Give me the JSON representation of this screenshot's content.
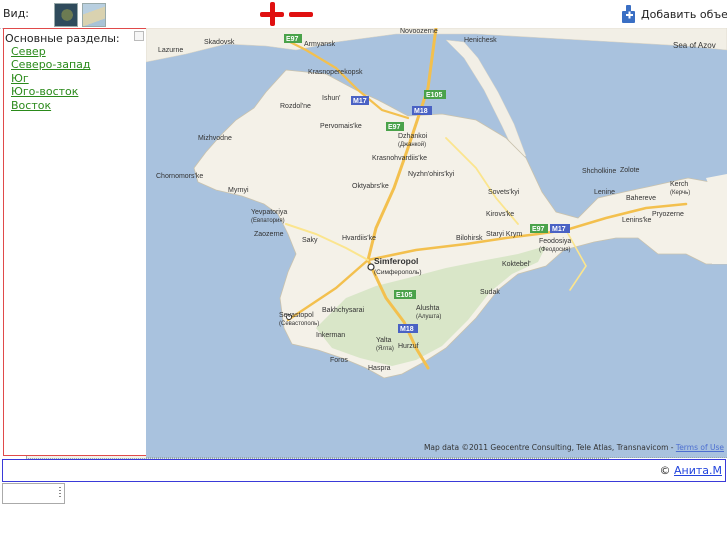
{
  "toolbar": {
    "view_label": "Вид:",
    "view_thumbs": [
      "map-thumbnail",
      "satellite-thumbnail",
      "hybrid-thumbnail"
    ],
    "zoom_in_icon": "plus-icon",
    "zoom_out_icon": "minus-icon",
    "add_object_label": "Добавить объект",
    "add_object_icon": "thumbs-up-plus-icon"
  },
  "sidebar": {
    "title": "Основные разделы:",
    "items": [
      "Север",
      "Северо-запад",
      "Юг",
      "Юго-восток",
      "Восток"
    ]
  },
  "map": {
    "attribution": "Map data ©2011 Geocentre Consulting, Tele Atlas, Transnavicom - ",
    "terms_link": "Terms of Use",
    "labels": {
      "sea_of_azov": "Sea of Azov",
      "simferopol": "Simferopol",
      "simferopol_ru": "(Симферополь)",
      "sevastopol": "Sevastopol",
      "sevastopol_ru": "(Севастополь)",
      "yevpatoriya": "Yevpatoriya",
      "yevpatoriya_ru": "(Евпатория)",
      "feodosiya": "Feodosiya",
      "feodosiya_ru": "(Феодосия)",
      "kerch": "Kerch",
      "kerch_ru": "(Керчь)",
      "dzhankoi": "Dzhankoi",
      "dzhankoi_ru": "(Джанкой)",
      "yalta": "Yalta",
      "yalta_ru": "(Ялта)",
      "alushta": "Alushta",
      "alushta_ru": "(Алушта)",
      "krasnoperekopsk": "Krasnoperekopsk",
      "armyansk": "Armyansk",
      "novoozerne": "Novoozerne",
      "rozdolne": "Rozdol'ne",
      "chornomorske": "Chornomors'ke",
      "saky": "Saky",
      "bakhchysarai": "Bakhchysarai",
      "inkerman": "Inkerman",
      "bilohirsk": "Bilohirsk",
      "staryi_krym": "Staryi Krym",
      "sudak": "Sudak",
      "kirovske": "Kirovs'ke",
      "lenine": "Lenine",
      "shcholkine": "Shcholkine",
      "oktiabrske": "Oktyabrs'ke",
      "krasnohvardiiske": "Krasnohvardiis'ke",
      "nyzhnohirskyi": "Nyzhn'ohirs'kyi",
      "pervomaiske": "Pervomais'ke",
      "hvardiiske": "Hvardiis'ke",
      "sovietskyi": "Sovets'kyi",
      "koktebel": "Koktebel'",
      "mizhvodne": "Mizhvodne",
      "myrnyi": "Myrnyi",
      "zaozerne": "Zaozerne",
      "hurzuf": "Hurzuf",
      "foros": "Foros",
      "haspra": "Haspra",
      "bahereve": "Bahereve",
      "pryozerne": "Pryozerne",
      "lenins_ke": "Lenins'ke",
      "zolote": "Zolote",
      "skadovsk": "Skadovsk",
      "lazurne": "Lazurne",
      "henichesk": "Henichesk",
      "ishun": "Ishun'",
      "dzhankoi_region": "Dzhankoi"
    },
    "road_shields": [
      "E97",
      "M17",
      "E105",
      "M18",
      "E97",
      "E97",
      "M17",
      "E105",
      "M18"
    ]
  },
  "footer": {
    "copyright": "© ",
    "author_link": "Анита.М"
  }
}
